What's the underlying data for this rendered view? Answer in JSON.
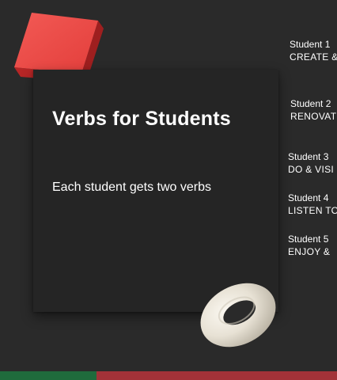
{
  "slide": {
    "title": "Verbs for Students",
    "subtitle": "Each student gets two verbs"
  },
  "students": [
    {
      "label": "Student 1",
      "verbs": "CREATE &"
    },
    {
      "label": "Student 2",
      "verbs": "RENOVAT"
    },
    {
      "label": "Student 3",
      "verbs": "DO & VISI"
    },
    {
      "label": "Student 4",
      "verbs": "LISTEN TO"
    },
    {
      "label": "Student 5",
      "verbs": "ENJOY &"
    }
  ],
  "decor": {
    "cube_color": "#e8413f",
    "torus_color": "#e9e4d8",
    "bottom_bar_colors": [
      "#1f6b3c",
      "#a23238"
    ]
  }
}
